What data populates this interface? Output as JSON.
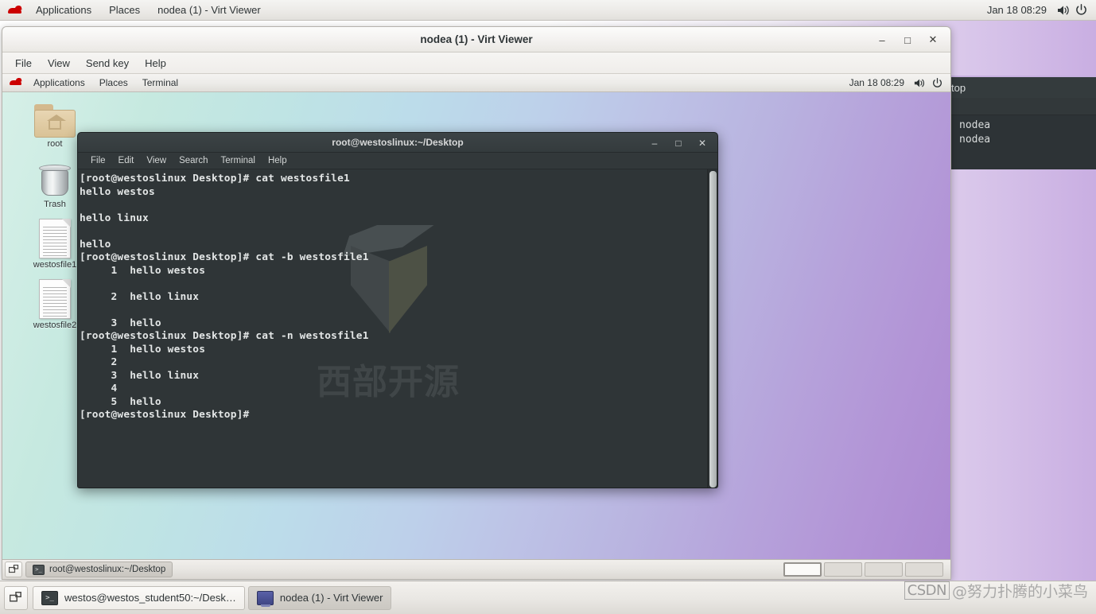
{
  "host_topbar": {
    "logo_icon": "redhat-logo-icon",
    "menus": [
      "Applications",
      "Places"
    ],
    "window_title": "nodea (1) - Virt Viewer",
    "clock": "Jan 18  08:29",
    "volume_icon": "volume-icon",
    "power_icon": "power-icon"
  },
  "virt_viewer": {
    "title": "nodea (1) - Virt Viewer",
    "menus": [
      "File",
      "View",
      "Send key",
      "Help"
    ],
    "window_buttons": {
      "minimize": "–",
      "maximize": "□",
      "close": "✕"
    }
  },
  "guest_topbar": {
    "menus": [
      "Applications",
      "Places",
      "Terminal"
    ],
    "clock": "Jan 18  08:29",
    "volume_icon": "volume-icon",
    "power_icon": "power-icon"
  },
  "desktop_icons": [
    {
      "label": "root",
      "icon": "home-folder-icon"
    },
    {
      "label": "Trash",
      "icon": "trash-icon"
    },
    {
      "label": "westosfile1",
      "icon": "text-file-icon"
    },
    {
      "label": "westosfile2",
      "icon": "text-file-icon"
    }
  ],
  "terminal": {
    "title": "root@westoslinux:~/Desktop",
    "menus": [
      "File",
      "Edit",
      "View",
      "Search",
      "Terminal",
      "Help"
    ],
    "window_buttons": {
      "minimize": "–",
      "maximize": "□",
      "close": "✕"
    },
    "content": "[root@westoslinux Desktop]# cat westosfile1\nhello westos\n\nhello linux\n\nhello\n[root@westoslinux Desktop]# cat -b westosfile1\n     1\thello westos\n\n     2\thello linux\n\n     3\thello\n[root@westoslinux Desktop]# cat -n westosfile1\n     1\thello westos\n     2\n     3\thello linux\n     4\n     5\thello\n[root@westoslinux Desktop]# ",
    "watermark_text": "西部开源"
  },
  "guest_bottombar": {
    "show_desktop_icon": "show-desktop-icon",
    "task": {
      "label": "root@westoslinux:~/Desktop",
      "icon": "terminal-icon"
    },
    "workspaces": [
      {
        "name": "workspace-1",
        "active": true
      },
      {
        "name": "workspace-2",
        "active": false
      },
      {
        "name": "workspace-3",
        "active": false
      },
      {
        "name": "workspace-4",
        "active": false
      }
    ]
  },
  "background_terminal": {
    "title_fragment": "top",
    "lines": "nodea\nnodea"
  },
  "host_bottombar": {
    "show_desktop_icon": "show-desktop-icon",
    "tasks": [
      {
        "label": "westos@westos_student50:~/Desk…",
        "icon": "terminal-icon",
        "active": false
      },
      {
        "label": "nodea (1) - Virt Viewer",
        "icon": "virt-viewer-icon",
        "active": true
      }
    ]
  },
  "watermark": {
    "badge": "CSDN",
    "handle": "@努力扑腾的小菜鸟"
  }
}
